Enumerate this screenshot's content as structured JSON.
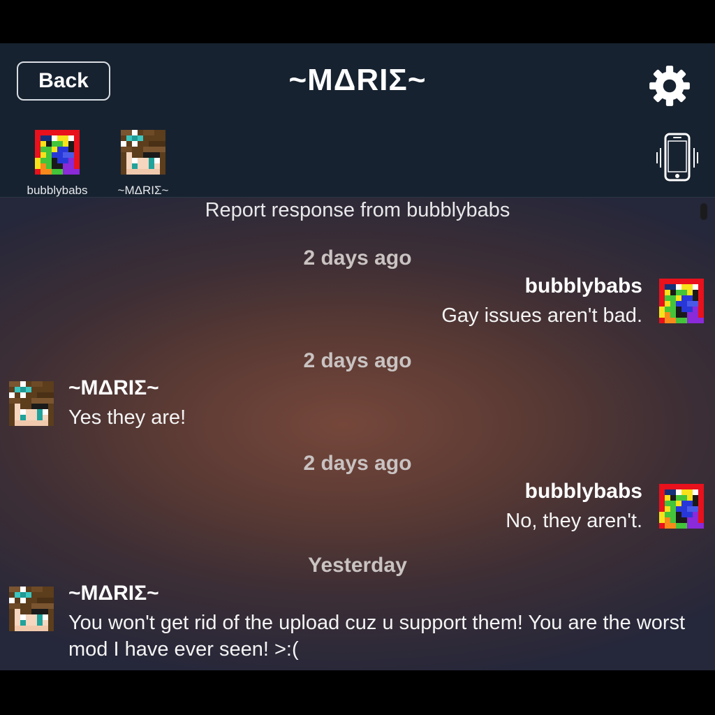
{
  "header": {
    "back_label": "Back",
    "title": "~MΔRIΣ~"
  },
  "participants": [
    {
      "name": "bubblybabs",
      "avatar": "rainbow-pixel-avatar"
    },
    {
      "name": "~MΔRIΣ~",
      "avatar": "girl-pixel-avatar"
    }
  ],
  "icons": {
    "settings": "gear-icon",
    "vibrate": "phone-vibrate-icon"
  },
  "chat": {
    "report_notice": "Report response from bubblybabs",
    "messages": [
      {
        "timestamp": "2 days ago",
        "sender": "bubblybabs",
        "text": "Gay issues aren't bad.",
        "side": "right"
      },
      {
        "timestamp": "2 days ago",
        "sender": "~MΔRIΣ~",
        "text": "Yes they are!",
        "side": "left"
      },
      {
        "timestamp": "2 days ago",
        "sender": "bubblybabs",
        "text": "No, they aren't.",
        "side": "right"
      },
      {
        "timestamp": "Yesterday",
        "sender": "~MΔRIΣ~",
        "text": "You won't get rid of the upload cuz u support them! You are the worst mod I have ever seen! >:(",
        "side": "left"
      }
    ]
  },
  "colors": {
    "header_bg": "#172230",
    "chat_warm": "#75473b",
    "chat_cool": "#25273a"
  }
}
